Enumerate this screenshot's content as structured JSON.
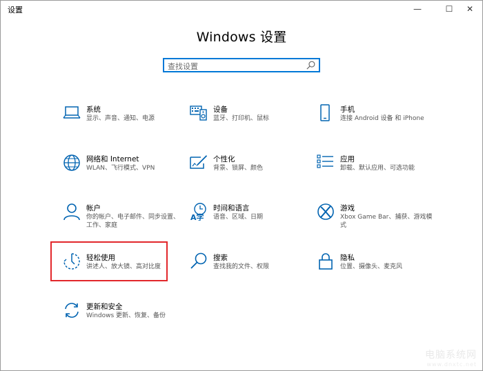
{
  "window": {
    "title": "设置",
    "minimize_glyph": "—",
    "maximize_glyph": "☐",
    "close_glyph": "✕"
  },
  "heading": "Windows 设置",
  "search": {
    "placeholder": "查找设置"
  },
  "accent_color": "#0078d7",
  "highlight_color": "#e2262a",
  "tiles": [
    {
      "name": "系统",
      "desc": "显示、声音、通知、电源",
      "icon": "laptop-icon"
    },
    {
      "name": "设备",
      "desc": "蓝牙、打印机、鼠标",
      "icon": "devices-icon"
    },
    {
      "name": "手机",
      "desc": "连接 Android 设备 和 iPhone",
      "icon": "phone-icon"
    },
    {
      "name": "网络和 Internet",
      "desc": "WLAN、飞行模式、VPN",
      "icon": "globe-icon"
    },
    {
      "name": "个性化",
      "desc": "背景、锁屏、颜色",
      "icon": "personalize-icon"
    },
    {
      "name": "应用",
      "desc": "卸载、默认应用、可选功能",
      "icon": "apps-icon"
    },
    {
      "name": "帐户",
      "desc": "你的帐户、电子邮件、同步设置、工作、家庭",
      "icon": "person-icon"
    },
    {
      "name": "时间和语言",
      "desc": "语音、区域、日期",
      "icon": "time-language-icon"
    },
    {
      "name": "游戏",
      "desc": "Xbox Game Bar、捕获、游戏模式",
      "icon": "xbox-icon"
    },
    {
      "name": "轻松使用",
      "desc": "讲述人、放大镜、高对比度",
      "icon": "ease-of-access-icon"
    },
    {
      "name": "搜索",
      "desc": "查找我的文件、权限",
      "icon": "search-icon"
    },
    {
      "name": "隐私",
      "desc": "位置、摄像头、麦克风",
      "icon": "lock-icon"
    },
    {
      "name": "更新和安全",
      "desc": "Windows 更新、恢复、备份",
      "icon": "update-icon"
    }
  ],
  "watermark": {
    "text": "电脑系统网",
    "sub": "www.dnxtc.net"
  }
}
